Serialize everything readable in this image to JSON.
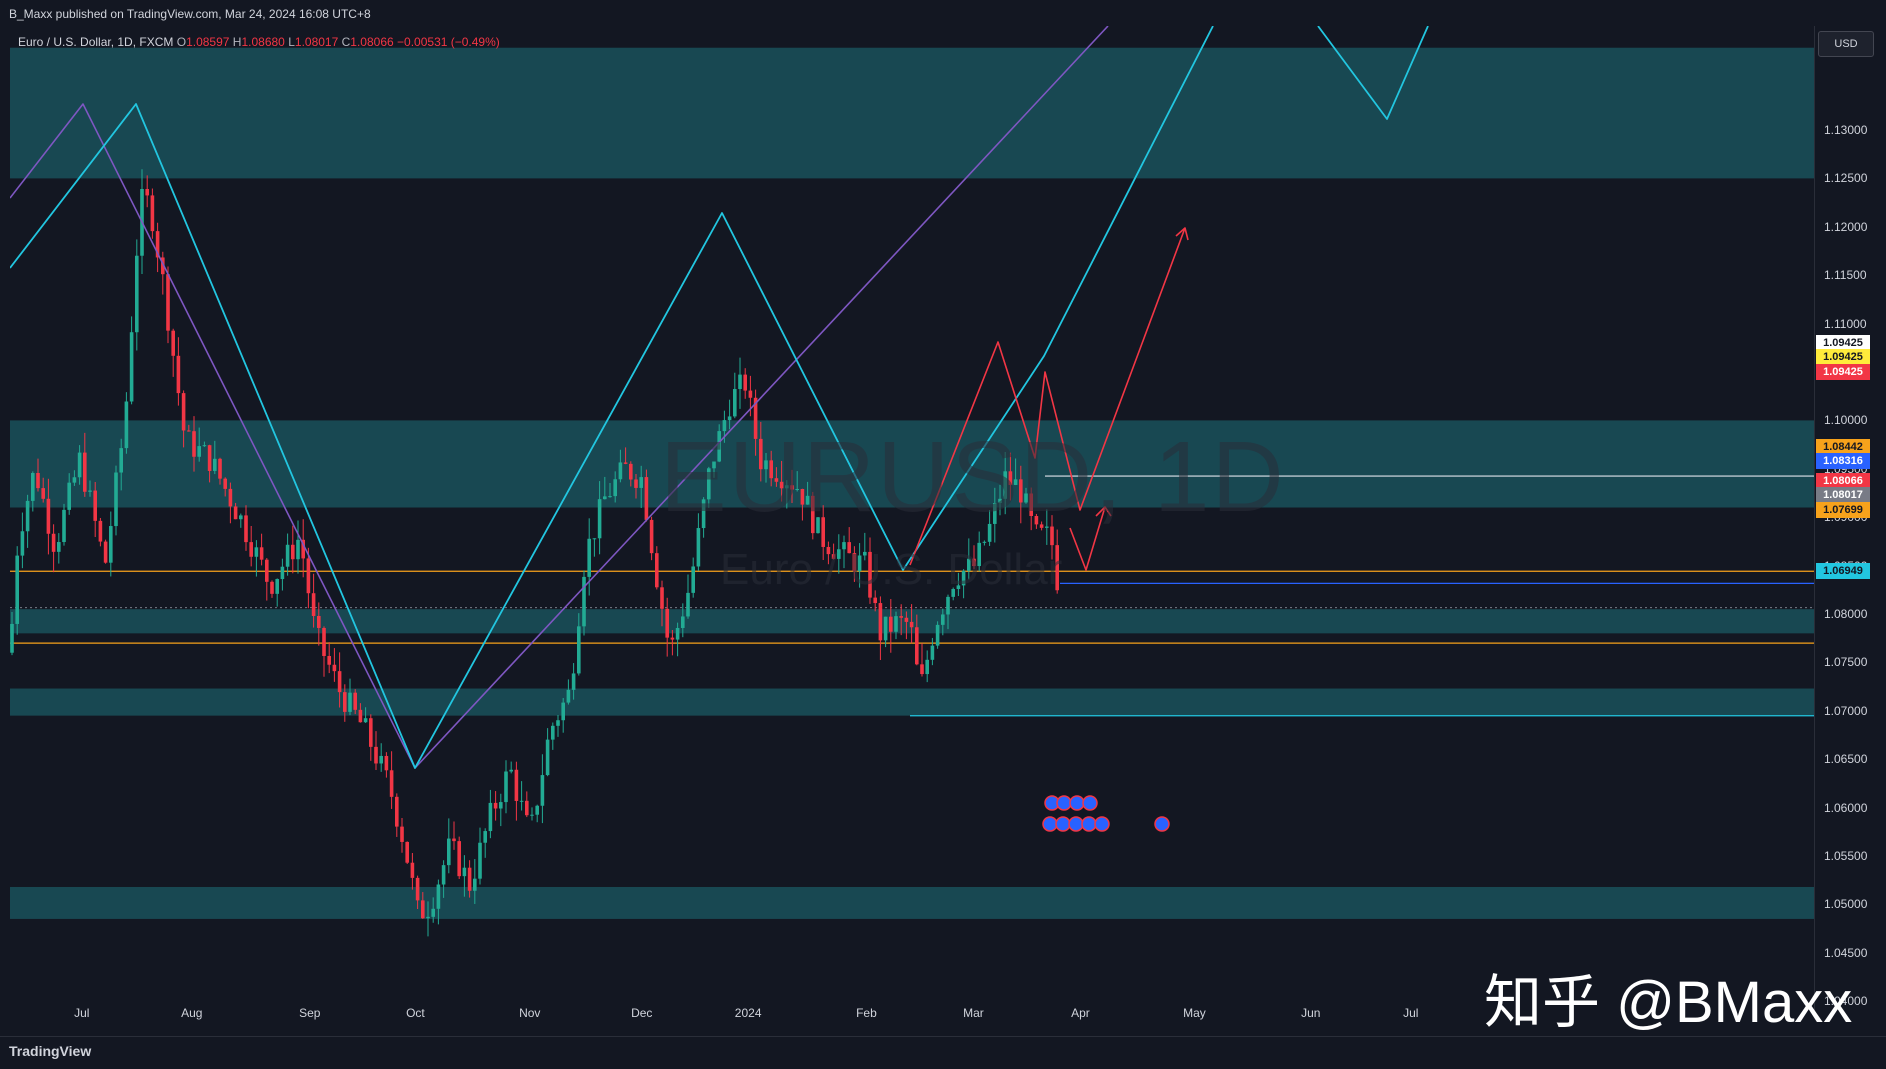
{
  "header": {
    "publish_line": "B_Maxx published on TradingView.com, Mar 24, 2024 16:08 UTC+8"
  },
  "legend": {
    "symbol_line": "Euro / U.S. Dollar, 1D, FXCM",
    "open_label": "O",
    "open": "1.08597",
    "high_label": "H",
    "high": "1.08680",
    "low_label": "L",
    "low": "1.08017",
    "close_label": "C",
    "close": "1.08066",
    "change": "−0.00531 (−0.49%)"
  },
  "watermark": {
    "symbol": "EURUSD, 1D",
    "description": "Euro / U.S. Dollar"
  },
  "currency_button": "USD",
  "footer": {
    "logo_text": "TradingView",
    "overlay_text": "知乎 @BMaxx"
  },
  "colors": {
    "bull": "#22ab94",
    "bear": "#f23645",
    "zone_fill": "#1b5a63",
    "cyan_line": "#22c6e0",
    "purple_line": "#7e57c2",
    "red_projection": "#f23645",
    "orange_level": "#f7a21b",
    "blue_level": "#2962ff"
  },
  "chart_data": {
    "type": "candlestick",
    "symbol": "EURUSD",
    "interval": "1D",
    "y_axis_labels": [
      "1.13000",
      "1.12500",
      "1.12000",
      "1.11500",
      "1.11000",
      "1.10500",
      "1.10000",
      "1.09500",
      "1.09000",
      "1.08500",
      "1.08000",
      "1.07500",
      "1.07000",
      "1.06500",
      "1.06000",
      "1.05500",
      "1.05000",
      "1.04500",
      "1.04000"
    ],
    "x_axis_labels": [
      "Jul",
      "Aug",
      "Sep",
      "Oct",
      "Nov",
      "Dec",
      "2024",
      "Feb",
      "Mar",
      "Apr",
      "May",
      "Jun",
      "Jul"
    ],
    "ylim": [
      1.037,
      1.1395
    ],
    "price_tags": [
      {
        "value": "1.09425",
        "bg": "#ffffff",
        "fg": "#131722"
      },
      {
        "value": "1.09425",
        "bg": "#ffeb3b",
        "fg": "#131722"
      },
      {
        "value": "1.09425",
        "bg": "#f23645",
        "fg": "#ffffff"
      },
      {
        "value": "1.08442",
        "bg": "#f7a21b",
        "fg": "#131722"
      },
      {
        "value": "1.08316",
        "bg": "#2962ff",
        "fg": "#ffffff"
      },
      {
        "value": "1.08066",
        "bg": "#f23645",
        "fg": "#ffffff"
      },
      {
        "value": "1.08017",
        "bg": "#787b86",
        "fg": "#ffffff"
      },
      {
        "value": "1.07699",
        "bg": "#f7a21b",
        "fg": "#131722"
      },
      {
        "value": "1.06949",
        "bg": "#22c6e0",
        "fg": "#131722"
      }
    ],
    "zones": [
      {
        "from": 1.125,
        "to": 1.1385
      },
      {
        "from": 1.091,
        "to": 1.1
      },
      {
        "from": 1.078,
        "to": 1.0805
      },
      {
        "from": 1.0695,
        "to": 1.0723
      },
      {
        "from": 1.0485,
        "to": 1.0518
      }
    ],
    "levels": [
      {
        "value": 1.08442,
        "color": "orange"
      },
      {
        "value": 1.07699,
        "color": "orange"
      },
      {
        "value": 1.08316,
        "color": "blue"
      },
      {
        "value": 1.09425,
        "color": "white"
      },
      {
        "value": 1.06949,
        "color": "cyan"
      }
    ],
    "pattern_points": {
      "cyan_zigzag": [
        1.1065,
        1.1275,
        1.045,
        1.114,
        1.0695,
        1.154,
        1.1258,
        1.142
      ],
      "purple_zigzag": [
        1.116,
        1.1275,
        1.045,
        1.141
      ],
      "red_projection": [
        1.0808,
        1.0985,
        1.0855,
        1.0942,
        1.0768,
        1.1125
      ],
      "red_small_projection": [
        1.075,
        1.0695,
        1.0773
      ]
    },
    "candles_summary": "Daily EURUSD from ~Jun 2023 to Mar 22 2024: peak ~1.1275 mid-Jul, low ~1.0450 early Oct, high ~1.1140 late Dec, low ~1.0695 mid-Feb, ~1.0980 early Mar, last close 1.08066"
  }
}
